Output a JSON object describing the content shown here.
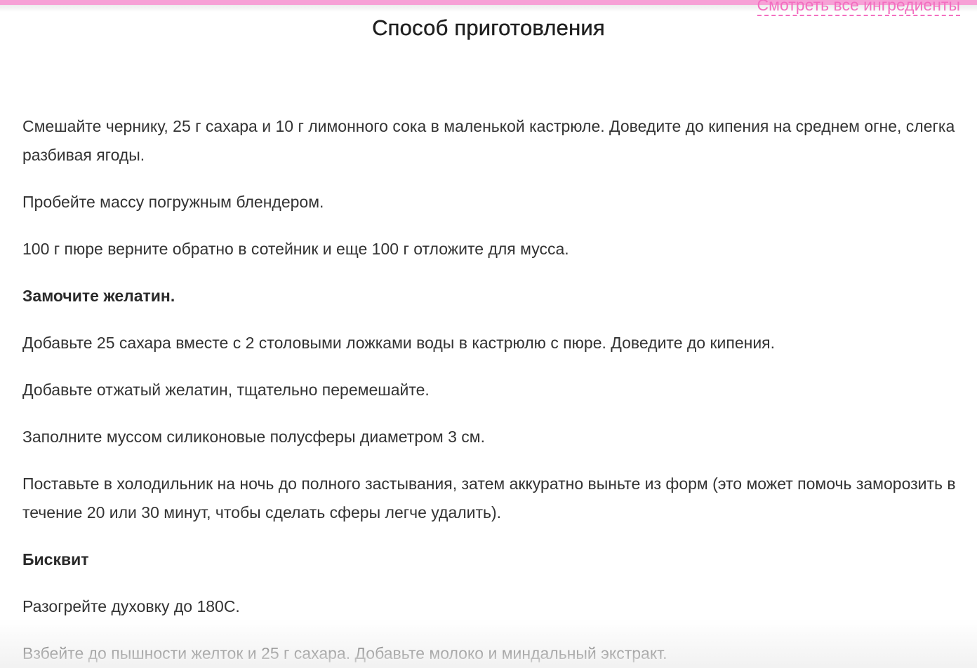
{
  "header": {
    "all_ingredients_link": "Смотреть все ингредиенты",
    "title": "Способ приготовления"
  },
  "steps": [
    {
      "text": "Смешайте чернику, 25  г сахара и 10 г лимонного сока в маленькой кастрюле. Доведите до кипения на среднем огне, слегка разбивая ягоды."
    },
    {
      "text": "Пробейте массу погружным блендером."
    },
    {
      "text": "100 г пюре верните обратно в сотейник и еще 100 г отложите для мусса."
    },
    {
      "text": "Замочите желатин."
    },
    {
      "text": "Добавьте 25 сахара вместе с 2 столовыми ложками воды в кастрюлю с пюре. Доведите до кипения."
    },
    {
      "text": "Добавьте отжатый желатин, тщательно перемешайте."
    },
    {
      "text": "Заполните муссом силиконовые полусферы диаметром 3 см."
    },
    {
      "text": "Поставьте в холодильник на ночь до полного застывания, затем аккуратно выньте из форм (это может помочь заморозить в течение 20 или 30 минут, чтобы сделать сферы легче удалить)."
    },
    {
      "text": "Бисквит"
    },
    {
      "text": "Разогрейте духовку до 180С."
    },
    {
      "text": "Взбейте до пышности желток и 25 г сахара. Добавьте молоко и миндальный экстракт."
    }
  ],
  "colors": {
    "accent_pink": "#f36fc0",
    "top_bar": "#f7a1d6"
  }
}
